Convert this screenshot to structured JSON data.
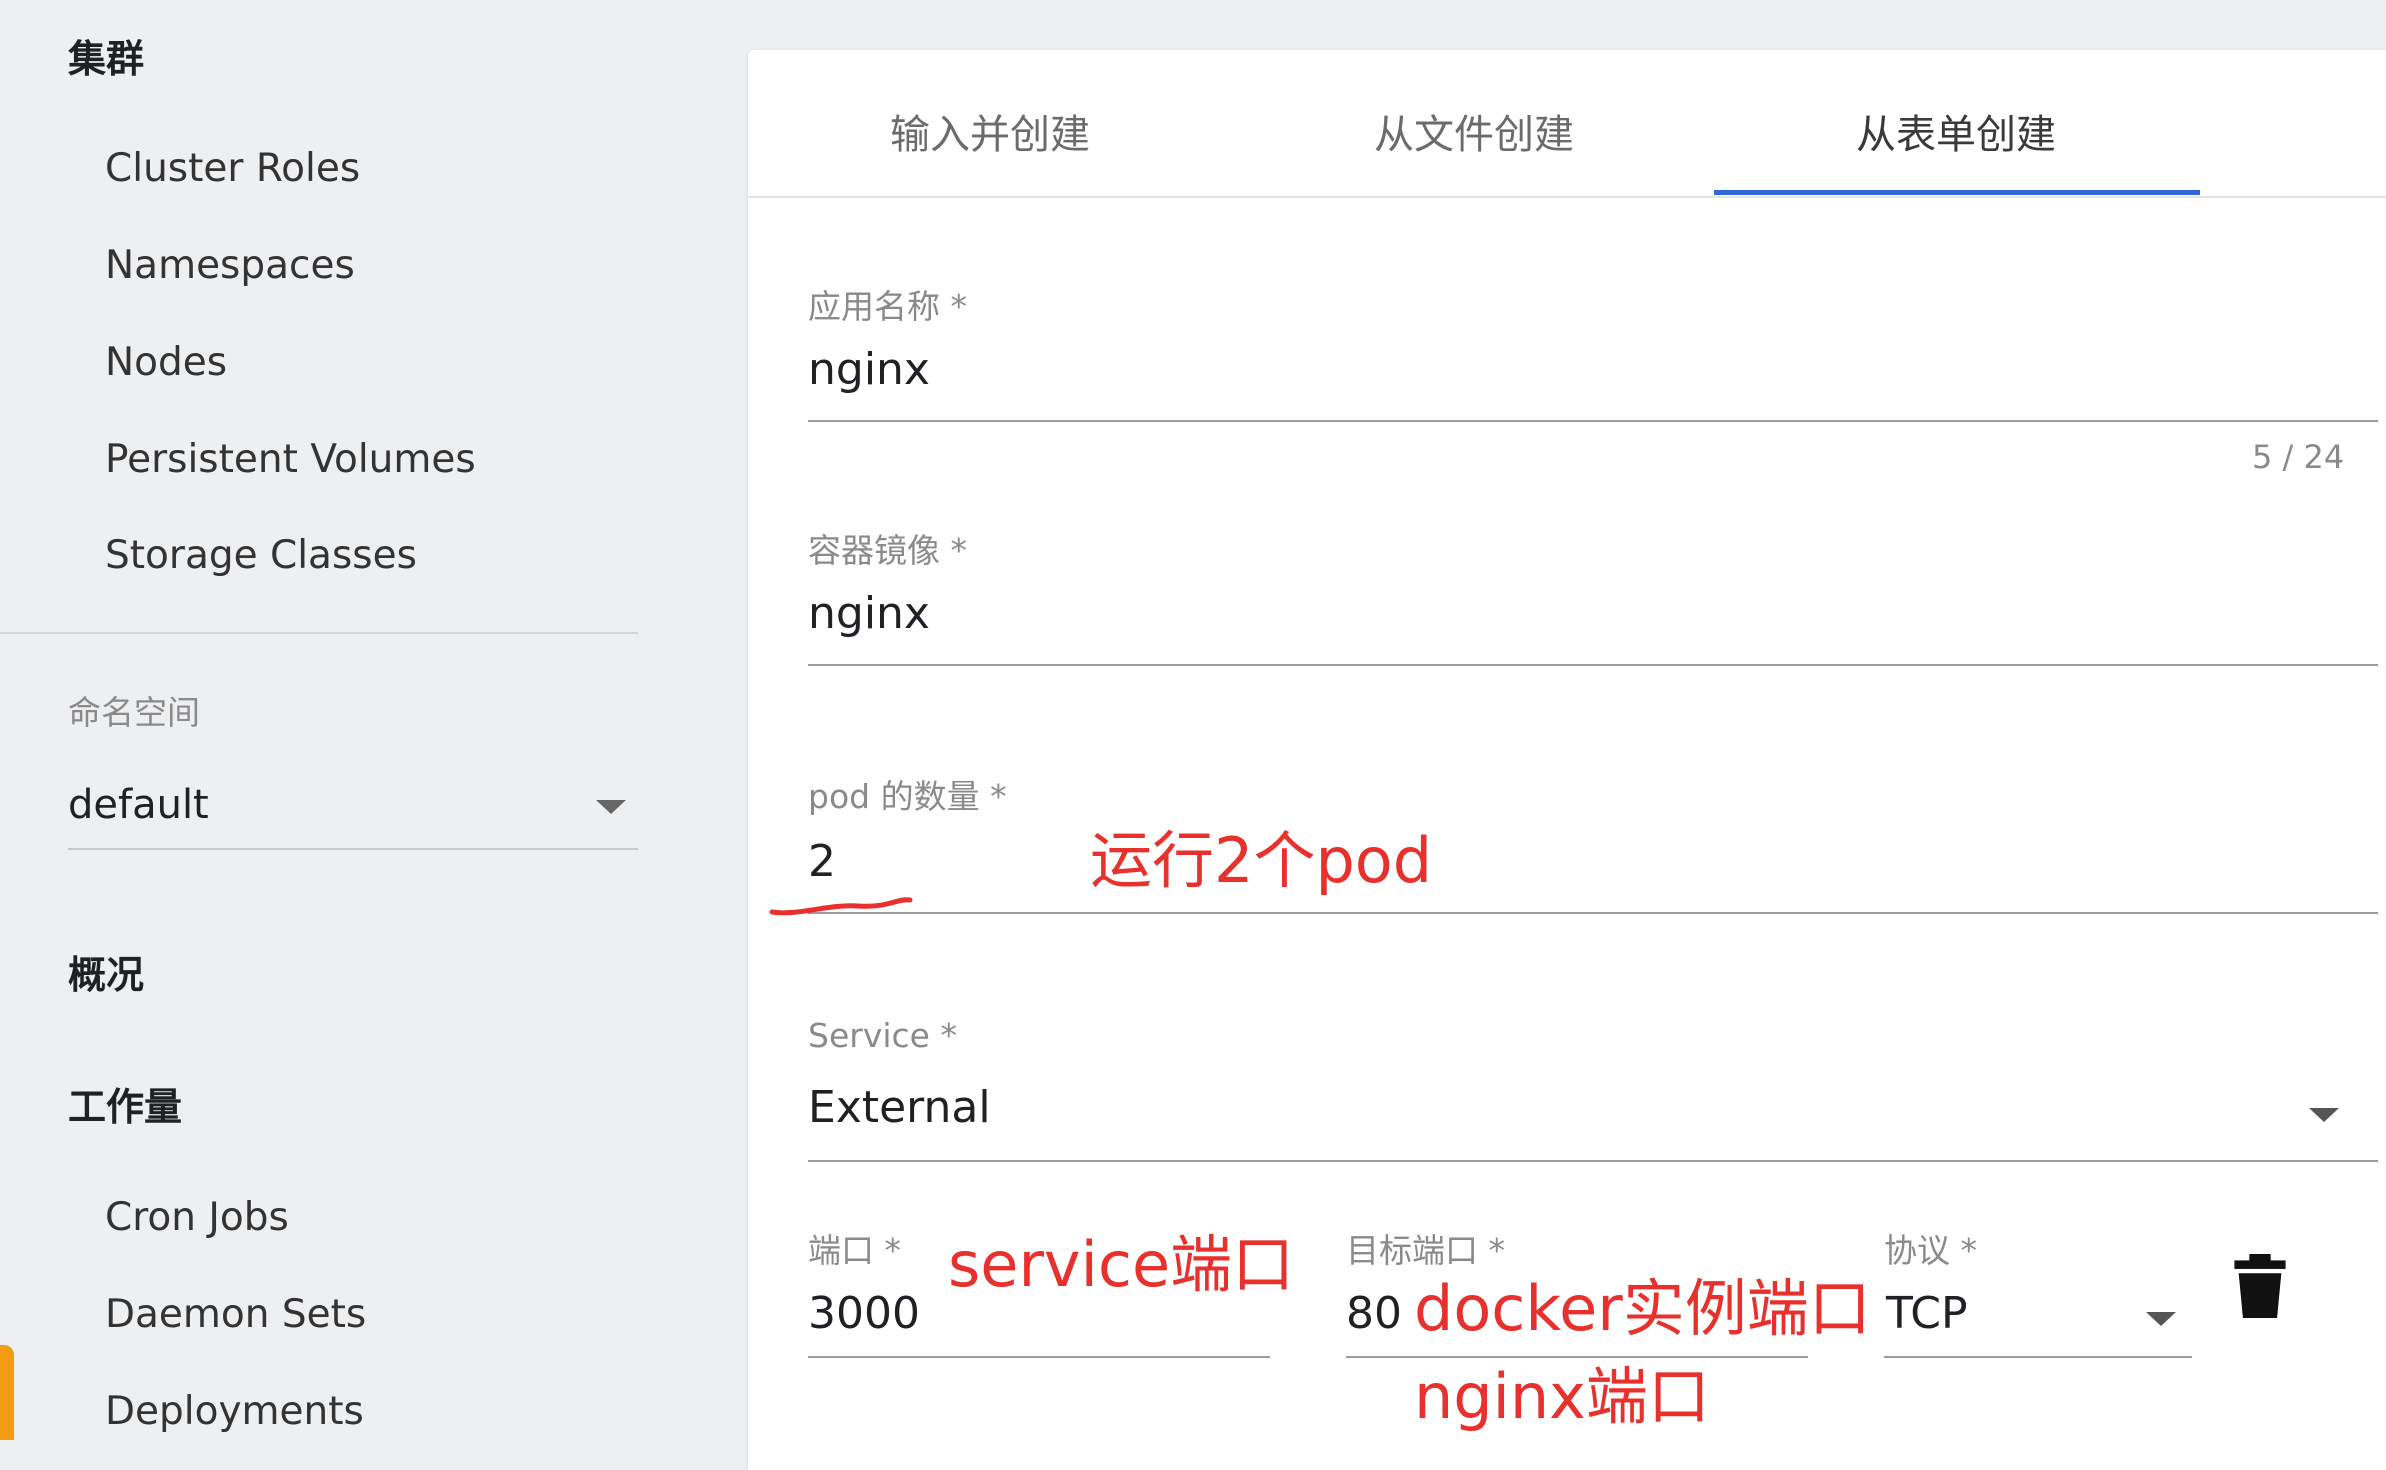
{
  "sidebar": {
    "cluster_heading": "集群",
    "cluster_items": [
      "Cluster Roles",
      "Namespaces",
      "Nodes",
      "Persistent Volumes",
      "Storage Classes"
    ],
    "namespace_label": "命名空间",
    "namespace_value": "default",
    "overview_heading": "概况",
    "workloads_heading": "工作量",
    "workload_items": [
      "Cron Jobs",
      "Daemon Sets",
      "Deployments"
    ]
  },
  "tabs": [
    "输入并创建",
    "从文件创建",
    "从表单创建"
  ],
  "active_tab": "从表单创建",
  "form": {
    "app_name": {
      "label": "应用名称 *",
      "value": "nginx",
      "counter": "5 / 24"
    },
    "image": {
      "label": "容器镜像 *",
      "value": "nginx"
    },
    "pods": {
      "label": "pod 的数量 *",
      "value": "2"
    },
    "service": {
      "label": "Service *",
      "value": "External"
    },
    "port": {
      "label": "端口 *",
      "value": "3000"
    },
    "target_port": {
      "label": "目标端口 *",
      "value": "80"
    },
    "protocol": {
      "label": "协议 *",
      "value": "TCP"
    }
  },
  "annotations": {
    "pods_note": "运行2个pod",
    "port_note": "service端口",
    "target_note_1": "docker实例端口",
    "target_note_2": "nginx端口"
  },
  "colors": {
    "accent": "#3366d6",
    "annotation": "#e8302c",
    "background": "#eeeff1"
  },
  "icons": {
    "delete": "trash-icon",
    "dropdown": "caret-down-icon"
  }
}
